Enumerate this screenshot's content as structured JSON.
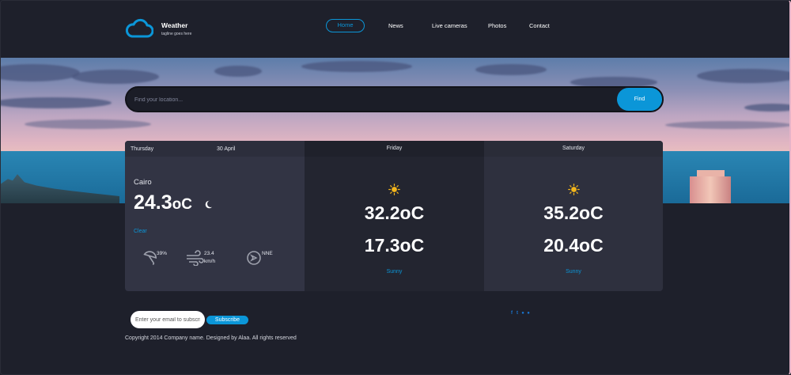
{
  "brand": {
    "title": "Weather",
    "tagline": "tagline goes here"
  },
  "nav": {
    "items": [
      {
        "label": "Home",
        "active": true
      },
      {
        "label": "News"
      },
      {
        "label": "Live cameras"
      },
      {
        "label": "Photos"
      },
      {
        "label": "Contact"
      }
    ]
  },
  "search": {
    "placeholder": "Find your location...",
    "button_label": "Find"
  },
  "today": {
    "day": "Thursday",
    "date": "30 April",
    "city": "Cairo",
    "temp": "24.3",
    "unit": "oC",
    "icon": "moon-icon",
    "description": "Clear",
    "humidity": "39%",
    "wind_speed": "23.4",
    "wind_unit": "km/h",
    "wind_dir": "NNE"
  },
  "forecast": [
    {
      "day": "Friday",
      "icon": "sun-icon",
      "high": "32.2",
      "low": "17.3",
      "unit": "oC",
      "description": "Sunny"
    },
    {
      "day": "Saturday",
      "icon": "sun-icon",
      "high": "35.2",
      "low": "20.4",
      "unit": "oC",
      "description": "Sunny"
    }
  ],
  "footer": {
    "email_placeholder": "Enter your email to subscribe",
    "subscribe_label": "Subscribe",
    "copyright": "Copyright 2014 Company name. Designed by Alaa. All rights reserved",
    "social_icons": [
      "facebook-icon",
      "twitter-icon",
      "google-icon",
      "pinterest-icon"
    ]
  },
  "colors": {
    "accent": "#0b96d8",
    "background": "#1e202b",
    "card": "#323444"
  }
}
